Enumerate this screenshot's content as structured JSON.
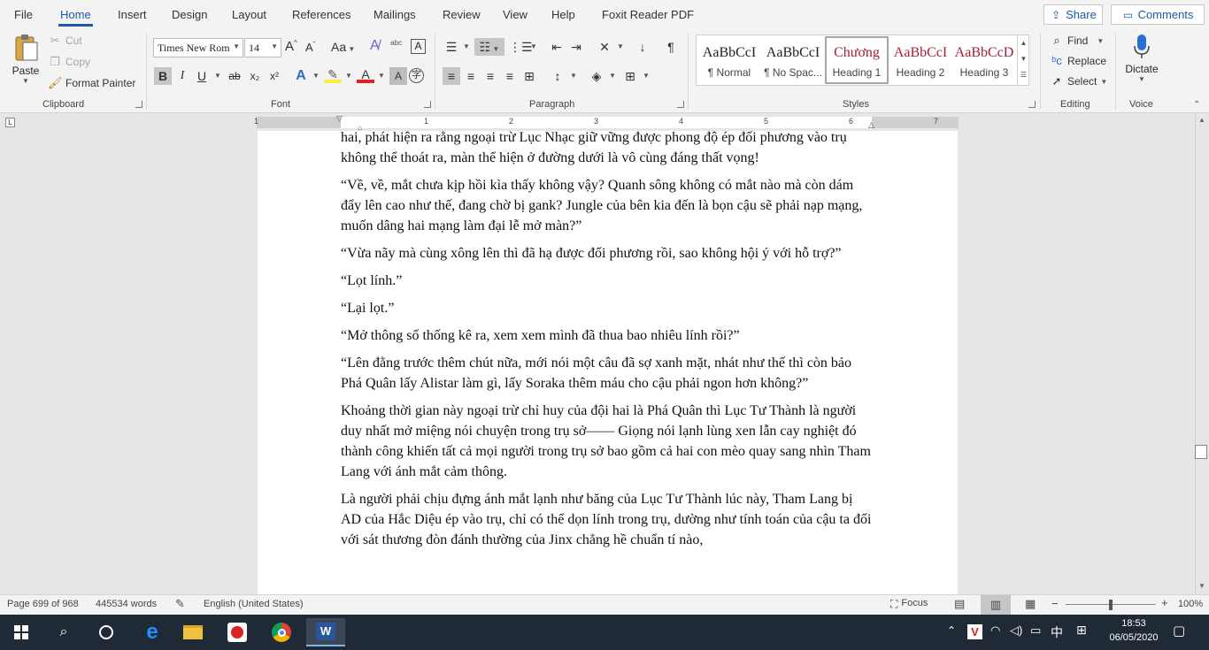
{
  "tabs": [
    "File",
    "Home",
    "Insert",
    "Design",
    "Layout",
    "References",
    "Mailings",
    "Review",
    "View",
    "Help",
    "Foxit Reader PDF"
  ],
  "share_label": "Share",
  "comments_label": "Comments",
  "clipboard": {
    "paste": "Paste",
    "cut": "Cut",
    "copy": "Copy",
    "format_painter": "Format Painter",
    "label": "Clipboard"
  },
  "font": {
    "name": "Times New Rom",
    "size": "14",
    "label": "Font",
    "case_btn": "Aa",
    "grow": "A",
    "shrink": "A"
  },
  "paragraph": {
    "label": "Paragraph"
  },
  "styles": {
    "label": "Styles",
    "items": [
      {
        "preview": "AaBbCcI",
        "name": "¶ Normal"
      },
      {
        "preview": "AaBbCcI",
        "name": "¶ No Spac..."
      },
      {
        "preview": "Chương",
        "name": "Heading 1"
      },
      {
        "preview": "AaBbCcI",
        "name": "Heading 2"
      },
      {
        "preview": "AaBbCcD",
        "name": "Heading 3"
      }
    ]
  },
  "editing": {
    "find": "Find",
    "replace": "Replace",
    "select": "Select",
    "label": "Editing"
  },
  "voice": {
    "dictate": "Dictate",
    "label": "Voice"
  },
  "ruler_numbers": [
    "1",
    "1",
    "2",
    "3",
    "4",
    "5",
    "6",
    "7"
  ],
  "document": {
    "paragraphs": [
      "hai, phát hiện ra rằng ngoại trừ Lục Nhạc giữ vững được phong độ ép đối phương vào trụ không thể thoát ra, màn thể hiện ở đường dưới là vô cùng đáng thất vọng!",
      "“Về, về, mắt chưa kịp hồi kìa thấy không vậy? Quanh sông không có mắt nào mà còn dám đẩy lên cao như thế, đang chờ bị gank? Jungle của bên kia đến là bọn cậu sẽ phải nạp mạng, muốn dâng hai mạng làm đại lễ mở màn?”",
      "“Vừa nãy mà cùng xông lên thì đã hạ được đối phương rồi, sao không hội ý với hỗ trợ?”",
      "“Lọt lính.”",
      "“Lại lọt.”",
      "“Mở thông số thống kê ra, xem xem mình đã thua bao nhiêu lính rồi?”",
      "“Lên đằng trước thêm chút nữa, mới nói một câu đã sợ xanh mặt, nhát như thế thì còn bảo Phá Quân lấy Alistar làm gì, lấy Soraka thêm máu cho cậu phải ngon hơn không?”",
      "Khoảng thời gian này ngoại trừ chỉ huy của đội hai là Phá Quân thì Lục Tư Thành là người duy nhất mở miệng nói chuyện trong trụ sở—— Giọng nói lạnh lùng xen lẫn cay nghiệt đó thành công khiến tất cả mọi người trong trụ sở bao gồm cả hai con mèo quay sang nhìn Tham Lang với ánh mắt cảm thông.",
      "Là người phải chịu đựng ánh mắt lạnh như băng của Lục Tư Thành lúc này, Tham Lang bị AD của Hắc Diệu ép vào trụ, chỉ có thể dọn lính trong trụ, dường như tính toán của cậu ta đối với sát thương đòn đánh thường của Jinx chẳng hề chuẩn tí nào,"
    ]
  },
  "status": {
    "page": "Page 699 of 968",
    "words": "445534 words",
    "language": "English (United States)",
    "focus": "Focus",
    "zoom": "100%"
  },
  "taskbar": {
    "time": "18:53",
    "date": "06/05/2020",
    "ime": "中"
  },
  "colors": {
    "accent": "#1b5aa6",
    "word_blue": "#2b579a",
    "taskbar": "#1f2a36"
  }
}
